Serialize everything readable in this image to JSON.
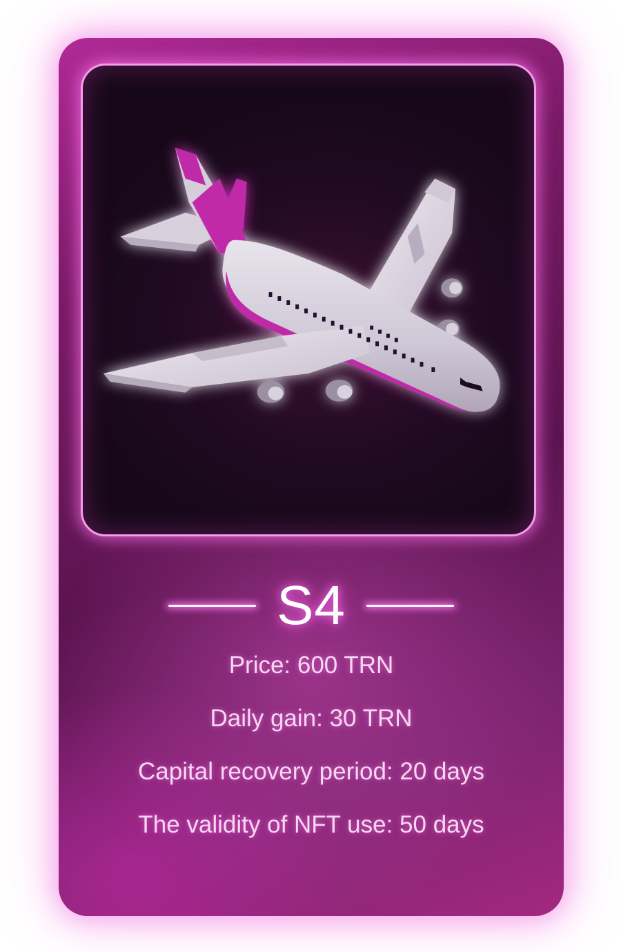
{
  "card": {
    "title": "S4",
    "image_alt": "airplane",
    "stats": [
      "Price: 600 TRN",
      "Daily gain: 30 TRN",
      "Capital recovery period: 20 days",
      "The validity of NFT use: 50 days"
    ]
  },
  "colors": {
    "card_base": "#7a1a66",
    "glow": "#f05adc",
    "frame_border": "#f59cea",
    "text": "#f6d8f2",
    "title": "#ffffff"
  }
}
